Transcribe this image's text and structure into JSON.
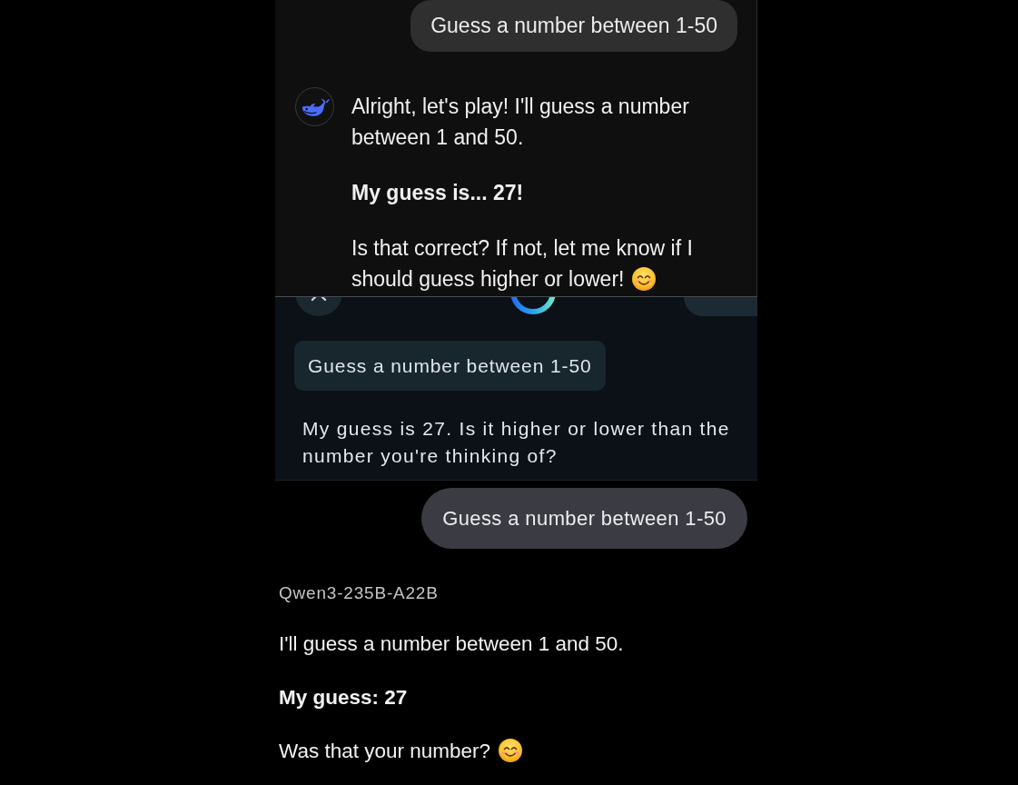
{
  "panels": [
    {
      "kind": "avatar",
      "user_message": "Guess a number between 1-50",
      "paragraphs": [
        {
          "text": "Alright, let's play! I'll guess a number between 1 and 50.",
          "bold": false,
          "smiley": false
        },
        {
          "text": "My guess is... 27!",
          "bold": true,
          "smiley": false
        },
        {
          "text": "Is that correct? If not, let me know if I should guess higher or lower!",
          "bold": false,
          "smiley": true
        }
      ]
    },
    {
      "kind": "sheet",
      "user_message": "Guess a number between 1-50",
      "paragraphs": [
        {
          "text": "My guess is 27. Is it higher or lower than the number you're thinking of?",
          "bold": false,
          "smiley": false
        }
      ]
    },
    {
      "kind": "plain",
      "user_message": "Guess a number between 1-50",
      "model_label": "Qwen3-235B-A22B",
      "paragraphs": [
        {
          "text": "I'll guess a number between 1 and 50.",
          "bold": false,
          "smiley": false
        },
        {
          "text": "My guess: 27",
          "bold": true,
          "smiley": false
        },
        {
          "text": "Was that your number?",
          "bold": false,
          "smiley": true
        }
      ]
    }
  ]
}
